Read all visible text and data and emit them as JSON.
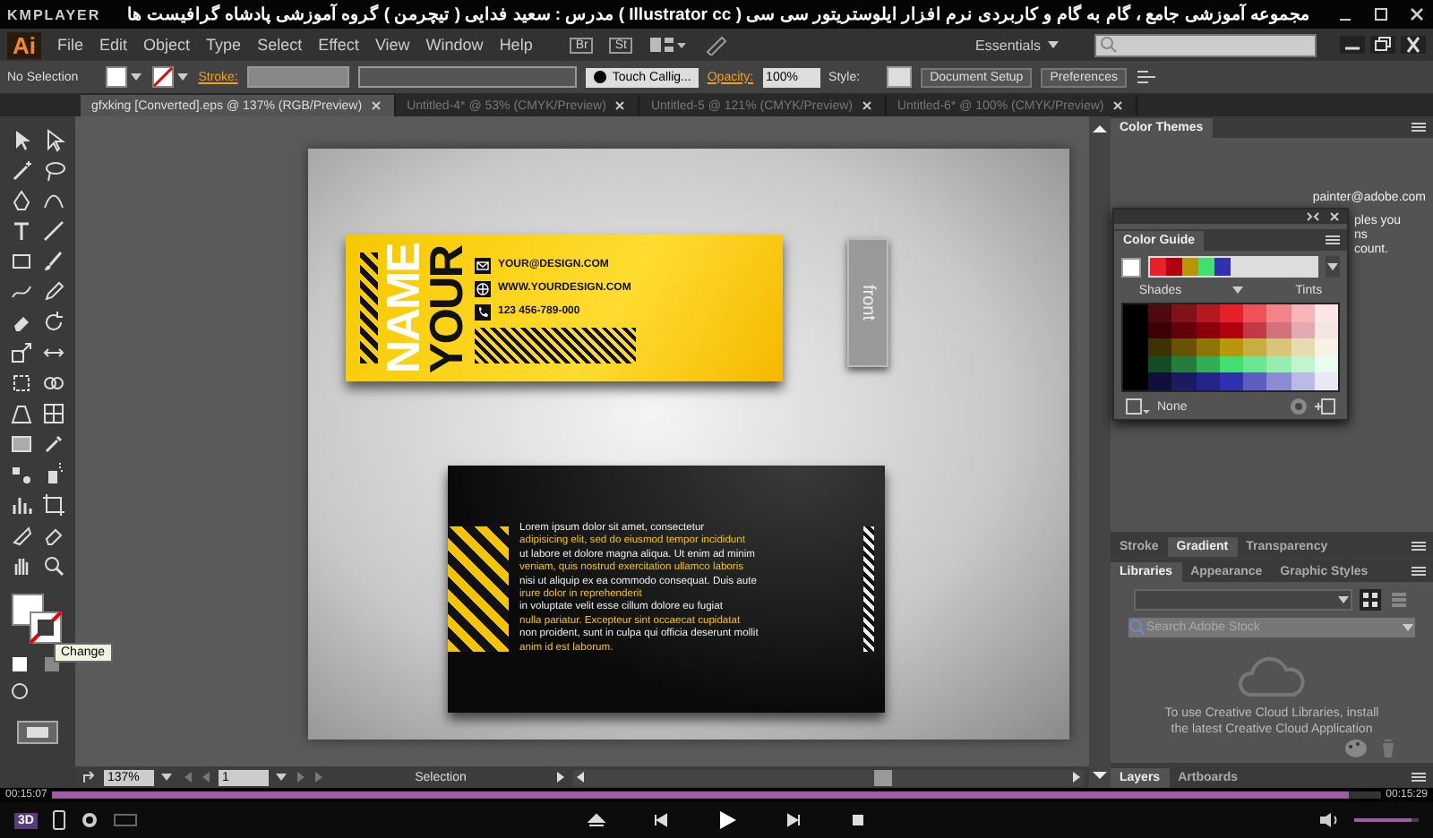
{
  "title_bar": {
    "app": "KMPLAYER",
    "title": "مجموعه آموزشی جامع ، گام به گام و کاربردی نرم افزار ایلوستریتور سی سی ( Illustrator cc )  مدرس : سعید فدایی ( تیچرمن ) گروه آموزشی پادشاه گرافیست ها"
  },
  "menu_bar": {
    "logo": "Ai",
    "items": [
      "File",
      "Edit",
      "Object",
      "Type",
      "Select",
      "Effect",
      "View",
      "Window",
      "Help"
    ],
    "bridge": "Br",
    "stock": "St",
    "workspace": "Essentials"
  },
  "control_bar": {
    "selection": "No Selection",
    "stroke_label": "Stroke:",
    "brush": "Touch Callig...",
    "opacity_label": "Opacity:",
    "opacity": "100%",
    "style_label": "Style:",
    "buttons": [
      "Document Setup",
      "Preferences"
    ]
  },
  "tabs": [
    {
      "label": "gfxking [Converted].eps @ 137% (RGB/Preview)",
      "selected": true
    },
    {
      "label": "Untitled-4* @ 53% (CMYK/Preview)",
      "selected": false
    },
    {
      "label": "Untitled-5 @ 121% (CMYK/Preview)",
      "selected": false
    },
    {
      "label": "Untitled-6* @ 100% (CMYK/Preview)",
      "selected": false
    }
  ],
  "tooltip": "Change",
  "artwork": {
    "front": {
      "name_lines": [
        "YOUR",
        "NAME"
      ],
      "contacts": [
        {
          "kind": "mail",
          "text": "YOUR@DESIGN.COM"
        },
        {
          "kind": "web",
          "text": "WWW.YOURDESIGN.COM"
        },
        {
          "kind": "phone",
          "text": "123 456-789-000"
        }
      ]
    },
    "front_label": "front",
    "back": {
      "lines": [
        {
          "text": "Lorem ipsum dolor sit amet, consectetur",
          "highlight": false
        },
        {
          "text": "adipisicing elit, sed do eiusmod tempor incididunt",
          "highlight": true
        },
        {
          "text": "ut labore et dolore magna aliqua. Ut enim ad minim",
          "highlight": false
        },
        {
          "text": "veniam, quis nostrud exercitation ullamco laboris",
          "highlight": true
        },
        {
          "text": "nisi ut aliquip ex ea commodo consequat. Duis aute",
          "highlight": false
        },
        {
          "text": "irure dolor in reprehenderit",
          "highlight": true
        },
        {
          "text": "in voluptate velit esse cillum dolore eu fugiat",
          "highlight": false
        },
        {
          "text": "nulla pariatur. Excepteur sint occaecat cupidatat",
          "highlight": true
        },
        {
          "text": "non proident, sunt in culpa qui officia deserunt mollit",
          "highlight": false
        },
        {
          "text": "anim id est laborum.",
          "highlight": true
        }
      ]
    }
  },
  "status_bar": {
    "zoom": "137%",
    "artboard": "1",
    "tool": "Selection"
  },
  "panels": {
    "color_themes": {
      "title": "Color Themes",
      "email": "painter@adobe.com",
      "fragments": [
        "ples you",
        "ns",
        "count."
      ]
    },
    "color_guide": {
      "title": "Color Guide",
      "harmony": [
        {
          "color": "#e8202a"
        },
        {
          "color": "#b00010"
        },
        {
          "color": "#b8960a"
        },
        {
          "color": "#40e070"
        },
        {
          "color": "#3030b0"
        }
      ],
      "shades_label": "Shades",
      "tints_label": "Tints",
      "group": "None"
    },
    "stroke_tabs": [
      {
        "label": "Stroke",
        "selected": false
      },
      {
        "label": "Gradient",
        "selected": true
      },
      {
        "label": "Transparency",
        "selected": false
      }
    ],
    "library_tabs": [
      {
        "label": "Libraries",
        "selected": true
      },
      {
        "label": "Appearance",
        "selected": false
      },
      {
        "label": "Graphic Styles",
        "selected": false
      }
    ],
    "search": {
      "placeholder": "Search Adobe Stock"
    },
    "message": "To use Creative Cloud Libraries, install the latest Creative Cloud Application",
    "layer_tabs": [
      {
        "label": "Layers",
        "selected": true
      },
      {
        "label": "Artboards",
        "selected": false
      }
    ]
  },
  "player": {
    "elapsed": "00:15:07",
    "total": "00:15:29",
    "progress": {
      "level": 0.976
    },
    "badge": "3D",
    "volume": {
      "level": 0.9
    }
  }
}
